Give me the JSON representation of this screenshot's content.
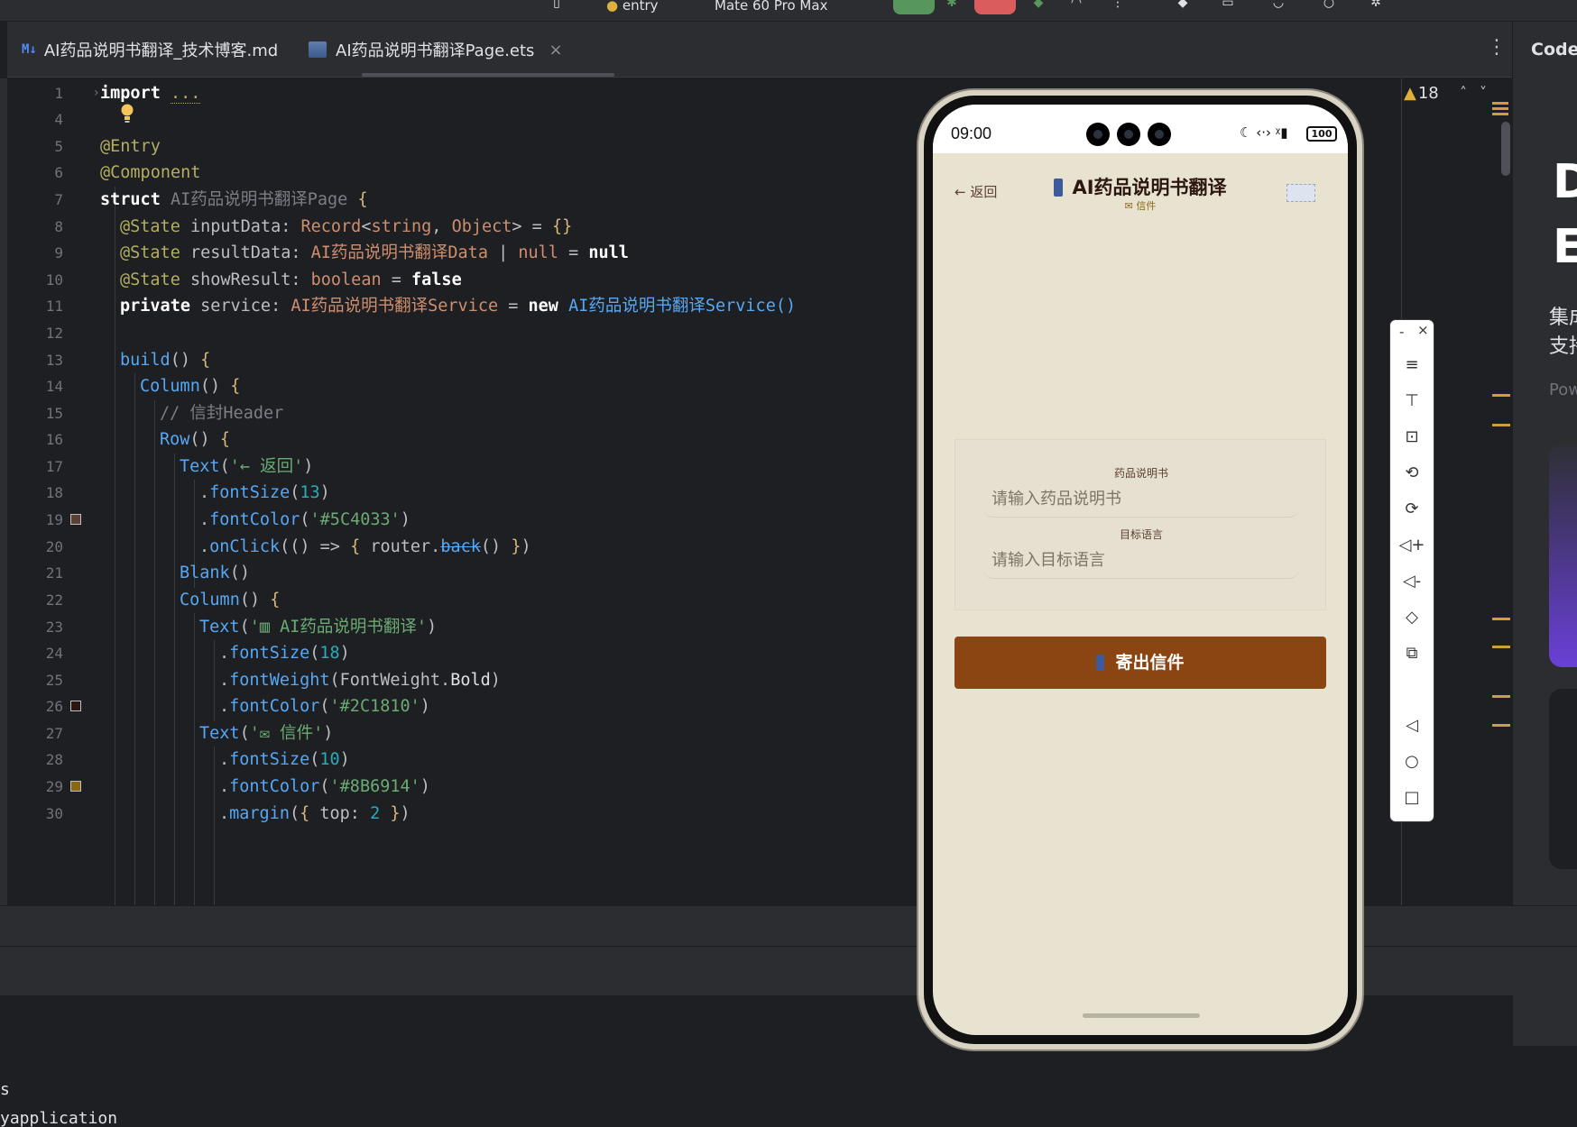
{
  "toolbar": {
    "device_label": "Mate 60 Pro Max",
    "module_label": "entry"
  },
  "tabs": [
    {
      "icon": "M↓",
      "label": "AI药品说明书翻译_技术博客.md",
      "active": false
    },
    {
      "icon": "ets",
      "label": "AI药品说明书翻译Page.ets",
      "active": true,
      "close": "×"
    }
  ],
  "editor": {
    "warning_count": "18",
    "folded_text": "...",
    "lines": [
      {
        "n": "1"
      },
      {
        "n": "4"
      },
      {
        "n": "5"
      },
      {
        "n": "6"
      },
      {
        "n": "7"
      },
      {
        "n": "8"
      },
      {
        "n": "9"
      },
      {
        "n": "10"
      },
      {
        "n": "11"
      },
      {
        "n": "12"
      },
      {
        "n": "13"
      },
      {
        "n": "14"
      },
      {
        "n": "15"
      },
      {
        "n": "16"
      },
      {
        "n": "17"
      },
      {
        "n": "18"
      },
      {
        "n": "19"
      },
      {
        "n": "20"
      },
      {
        "n": "21"
      },
      {
        "n": "22"
      },
      {
        "n": "23"
      },
      {
        "n": "24"
      },
      {
        "n": "25"
      },
      {
        "n": "26"
      },
      {
        "n": "27"
      },
      {
        "n": "28"
      },
      {
        "n": "29"
      },
      {
        "n": "30"
      }
    ],
    "gutter_colors": {
      "19": "#5C4033",
      "26": "#2C1810",
      "29": "#8B6914"
    }
  },
  "right_panel": {
    "title": "CodeG",
    "big1": "D",
    "big2": "E",
    "line1": "集成",
    "line2": "支持",
    "powered": "Pow"
  },
  "terminal": {
    "line1": "s",
    "line2": "yapplication"
  },
  "phone": {
    "time": "09:00",
    "battery": "100",
    "back_label": "← 返回",
    "title": "AI药品说明书翻译",
    "subtitle": "✉ 信件",
    "field1_label": "药品说明书",
    "field1_placeholder": "请输入药品说明书",
    "field2_label": "目标语言",
    "field2_placeholder": "请输入目标语言",
    "submit_label": "寄出信件",
    "colors": {
      "background": "#E8E2D1",
      "button": "#8B4513",
      "title": "#2C1810",
      "accent": "#8B6914",
      "back": "#5C4033"
    }
  },
  "emulator_toolbar": {
    "buttons": [
      "menu-icon",
      "pin-top-icon",
      "crop-icon",
      "rotate-left-icon",
      "rotate-right-icon",
      "volume-up-icon",
      "volume-down-icon",
      "shake-icon",
      "screenshot-icon",
      "back-nav-icon",
      "home-nav-icon",
      "recent-nav-icon"
    ],
    "minimize": "-",
    "close": "×"
  }
}
